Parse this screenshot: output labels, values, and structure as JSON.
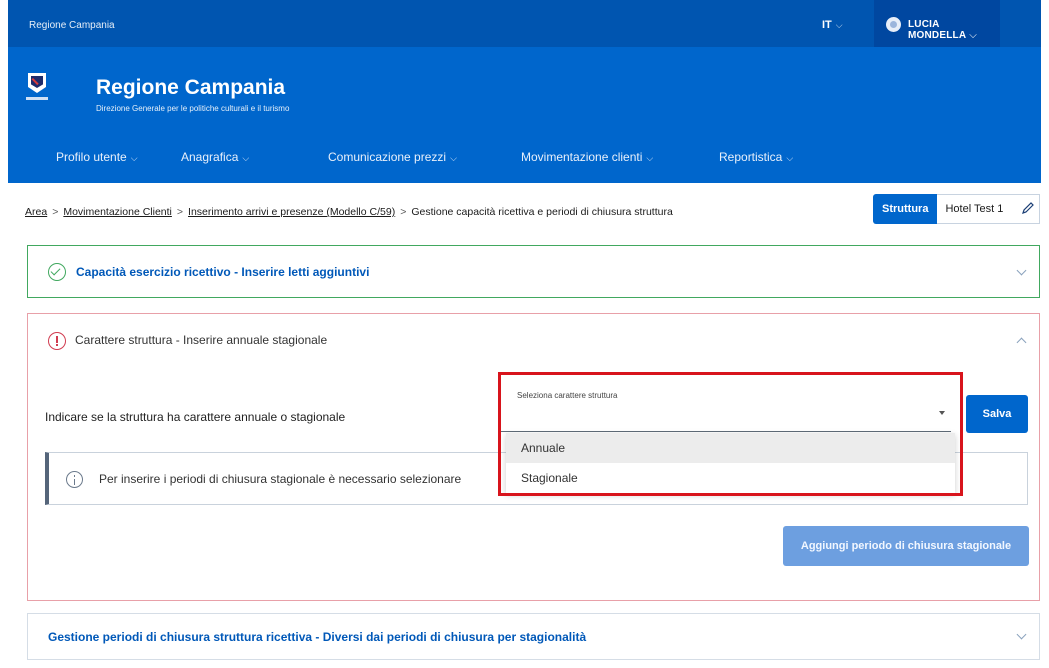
{
  "topbar": {
    "region": "Regione Campania",
    "lang": "IT",
    "user": "LUCIA MONDELLA"
  },
  "header": {
    "title": "Regione Campania",
    "subtitle": "Direzione Generale per le politiche culturali e il turismo"
  },
  "nav": {
    "items": [
      {
        "label": "Profilo utente"
      },
      {
        "label": "Anagrafica"
      },
      {
        "label": "Comunicazione prezzi"
      },
      {
        "label": "Movimentazione clienti"
      },
      {
        "label": "Reportistica"
      }
    ]
  },
  "breadcrumb": {
    "items": [
      "Area",
      "Movimentazione Clienti",
      "Inserimento arrivi e presenze (Modello C/59)"
    ],
    "current": "Gestione capacità ricettiva e periodi di chiusura struttura",
    "separator": ">"
  },
  "struttura": {
    "label": "Struttura",
    "value": "Hotel Test 1"
  },
  "panels": {
    "capacita": {
      "title": "Capacità esercizio ricettivo - Inserire letti aggiuntivi"
    },
    "carattere": {
      "title": "Carattere struttura - Inserire annuale stagionale",
      "question": "Indicare se la struttura ha carattere annuale o stagionale",
      "select_label": "Seleziona carattere struttura",
      "options": [
        "Annuale",
        "Stagionale"
      ],
      "save_label": "Salva",
      "info": "Per inserire i periodi di chiusura stagionale è necessario selezionare",
      "add_label": "Aggiungi periodo di chiusura stagionale"
    },
    "chiusura": {
      "title": "Gestione periodi di chiusura struttura ricettiva - Diversi dai periodi di chiusura per stagionalità"
    }
  },
  "colors": {
    "header": "#0066cc",
    "slimbar": "#0055b0",
    "success": "#41a85f",
    "error": "#d13c50",
    "annotation": "#d8141c"
  }
}
